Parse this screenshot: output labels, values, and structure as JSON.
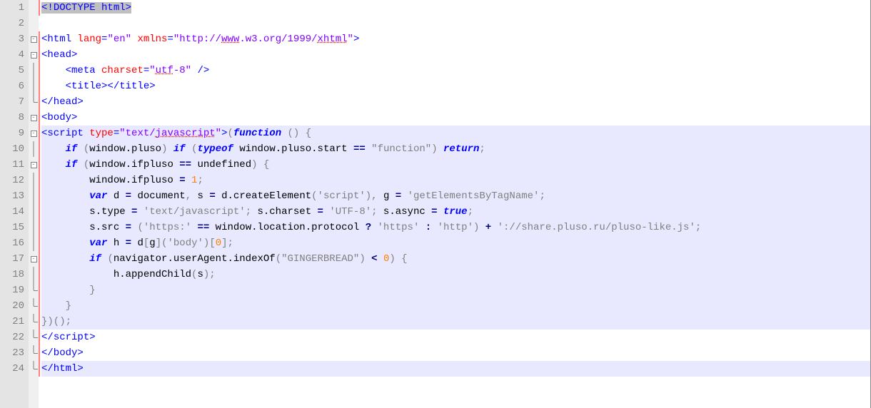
{
  "lines": [
    {
      "n": 1,
      "fold": "",
      "markred": true,
      "hl": false,
      "tokens": [
        {
          "t": "sel",
          "v": "<!"
        },
        {
          "t": "sel",
          "v": "DOCTYPE html"
        },
        {
          "t": "sel",
          "v": ">"
        }
      ]
    },
    {
      "n": 2,
      "fold": "",
      "markred": false,
      "hl": false,
      "tokens": []
    },
    {
      "n": 3,
      "fold": "box",
      "markred": true,
      "hl": false,
      "tokens": [
        {
          "t": "tag",
          "v": "<html "
        },
        {
          "t": "attr",
          "v": "lang"
        },
        {
          "t": "tag",
          "v": "="
        },
        {
          "t": "val",
          "v": "\"en\""
        },
        {
          "t": "tag",
          "v": " "
        },
        {
          "t": "attr",
          "v": "xmlns"
        },
        {
          "t": "tag",
          "v": "="
        },
        {
          "t": "val",
          "v": "\"http://"
        },
        {
          "t": "valund",
          "v": "www"
        },
        {
          "t": "val",
          "v": ".w3.org/1999/"
        },
        {
          "t": "valund",
          "v": "xhtml"
        },
        {
          "t": "val",
          "v": "\""
        },
        {
          "t": "tag",
          "v": ">"
        }
      ]
    },
    {
      "n": 4,
      "fold": "box",
      "markred": true,
      "hl": false,
      "tokens": [
        {
          "t": "tag",
          "v": "<head>"
        }
      ]
    },
    {
      "n": 5,
      "fold": "line",
      "markred": true,
      "hl": false,
      "tokens": [
        {
          "t": "txt",
          "v": "    "
        },
        {
          "t": "tag",
          "v": "<meta "
        },
        {
          "t": "attr",
          "v": "charset"
        },
        {
          "t": "tag",
          "v": "="
        },
        {
          "t": "val",
          "v": "\""
        },
        {
          "t": "valund",
          "v": "utf"
        },
        {
          "t": "val",
          "v": "-8\""
        },
        {
          "t": "tag",
          "v": " />"
        }
      ]
    },
    {
      "n": 6,
      "fold": "line",
      "markred": true,
      "hl": false,
      "tokens": [
        {
          "t": "txt",
          "v": "    "
        },
        {
          "t": "tag",
          "v": "<title></title>"
        }
      ]
    },
    {
      "n": 7,
      "fold": "end",
      "markred": true,
      "hl": false,
      "tokens": [
        {
          "t": "tag",
          "v": "</head>"
        }
      ]
    },
    {
      "n": 8,
      "fold": "box",
      "markred": true,
      "hl": false,
      "tokens": [
        {
          "t": "tag",
          "v": "<body>"
        }
      ]
    },
    {
      "n": 9,
      "fold": "box",
      "markred": true,
      "hl": true,
      "tokens": [
        {
          "t": "tag",
          "v": "<script "
        },
        {
          "t": "attr",
          "v": "type"
        },
        {
          "t": "tag",
          "v": "="
        },
        {
          "t": "val",
          "v": "\"text/"
        },
        {
          "t": "valund",
          "v": "javascript"
        },
        {
          "t": "val",
          "v": "\""
        },
        {
          "t": "tag",
          "v": ">"
        },
        {
          "t": "grey",
          "v": "("
        },
        {
          "t": "kw",
          "v": "function"
        },
        {
          "t": "txt",
          "v": " "
        },
        {
          "t": "grey",
          "v": "() {"
        }
      ]
    },
    {
      "n": 10,
      "fold": "line",
      "markred": true,
      "hl": true,
      "tokens": [
        {
          "t": "txt",
          "v": "    "
        },
        {
          "t": "kw",
          "v": "if"
        },
        {
          "t": "txt",
          "v": " "
        },
        {
          "t": "grey",
          "v": "("
        },
        {
          "t": "txt",
          "v": "window.pluso"
        },
        {
          "t": "grey",
          "v": ")"
        },
        {
          "t": "txt",
          "v": " "
        },
        {
          "t": "kw",
          "v": "if"
        },
        {
          "t": "txt",
          "v": " "
        },
        {
          "t": "grey",
          "v": "("
        },
        {
          "t": "kw",
          "v": "typeof"
        },
        {
          "t": "txt",
          "v": " window.pluso.start "
        },
        {
          "t": "op",
          "v": "=="
        },
        {
          "t": "txt",
          "v": " "
        },
        {
          "t": "str",
          "v": "\"function\""
        },
        {
          "t": "grey",
          "v": ")"
        },
        {
          "t": "txt",
          "v": " "
        },
        {
          "t": "kw",
          "v": "return"
        },
        {
          "t": "grey",
          "v": ";"
        }
      ]
    },
    {
      "n": 11,
      "fold": "box",
      "markred": true,
      "hl": true,
      "tokens": [
        {
          "t": "txt",
          "v": "    "
        },
        {
          "t": "kw",
          "v": "if"
        },
        {
          "t": "txt",
          "v": " "
        },
        {
          "t": "grey",
          "v": "("
        },
        {
          "t": "txt",
          "v": "window.ifpluso "
        },
        {
          "t": "op",
          "v": "=="
        },
        {
          "t": "txt",
          "v": " undefined"
        },
        {
          "t": "grey",
          "v": ") {"
        }
      ]
    },
    {
      "n": 12,
      "fold": "line",
      "markred": true,
      "hl": true,
      "tokens": [
        {
          "t": "txt",
          "v": "        window.ifpluso "
        },
        {
          "t": "op",
          "v": "="
        },
        {
          "t": "txt",
          "v": " "
        },
        {
          "t": "num",
          "v": "1"
        },
        {
          "t": "grey",
          "v": ";"
        }
      ]
    },
    {
      "n": 13,
      "fold": "line",
      "markred": true,
      "hl": true,
      "tokens": [
        {
          "t": "txt",
          "v": "        "
        },
        {
          "t": "kw",
          "v": "var"
        },
        {
          "t": "txt",
          "v": " d "
        },
        {
          "t": "op",
          "v": "="
        },
        {
          "t": "txt",
          "v": " document"
        },
        {
          "t": "grey",
          "v": ","
        },
        {
          "t": "txt",
          "v": " s "
        },
        {
          "t": "op",
          "v": "="
        },
        {
          "t": "txt",
          "v": " d.createElement"
        },
        {
          "t": "grey",
          "v": "("
        },
        {
          "t": "str",
          "v": "'script'"
        },
        {
          "t": "grey",
          "v": "),"
        },
        {
          "t": "txt",
          "v": " g "
        },
        {
          "t": "op",
          "v": "="
        },
        {
          "t": "txt",
          "v": " "
        },
        {
          "t": "str",
          "v": "'getElementsByTagName'"
        },
        {
          "t": "grey",
          "v": ";"
        }
      ]
    },
    {
      "n": 14,
      "fold": "line",
      "markred": true,
      "hl": true,
      "tokens": [
        {
          "t": "txt",
          "v": "        s.type "
        },
        {
          "t": "op",
          "v": "="
        },
        {
          "t": "txt",
          "v": " "
        },
        {
          "t": "str",
          "v": "'text/javascript'"
        },
        {
          "t": "grey",
          "v": ";"
        },
        {
          "t": "txt",
          "v": " s.charset "
        },
        {
          "t": "op",
          "v": "="
        },
        {
          "t": "txt",
          "v": " "
        },
        {
          "t": "str",
          "v": "'UTF-8'"
        },
        {
          "t": "grey",
          "v": ";"
        },
        {
          "t": "txt",
          "v": " s.async "
        },
        {
          "t": "op",
          "v": "="
        },
        {
          "t": "txt",
          "v": " "
        },
        {
          "t": "kw",
          "v": "true"
        },
        {
          "t": "grey",
          "v": ";"
        }
      ]
    },
    {
      "n": 15,
      "fold": "line",
      "markred": true,
      "hl": true,
      "tokens": [
        {
          "t": "txt",
          "v": "        s.src "
        },
        {
          "t": "op",
          "v": "="
        },
        {
          "t": "txt",
          "v": " "
        },
        {
          "t": "grey",
          "v": "("
        },
        {
          "t": "str",
          "v": "'https:'"
        },
        {
          "t": "txt",
          "v": " "
        },
        {
          "t": "op",
          "v": "=="
        },
        {
          "t": "txt",
          "v": " window.location.protocol "
        },
        {
          "t": "op",
          "v": "?"
        },
        {
          "t": "txt",
          "v": " "
        },
        {
          "t": "str",
          "v": "'https'"
        },
        {
          "t": "txt",
          "v": " "
        },
        {
          "t": "op",
          "v": ":"
        },
        {
          "t": "txt",
          "v": " "
        },
        {
          "t": "str",
          "v": "'http'"
        },
        {
          "t": "grey",
          "v": ")"
        },
        {
          "t": "txt",
          "v": " "
        },
        {
          "t": "op",
          "v": "+"
        },
        {
          "t": "txt",
          "v": " "
        },
        {
          "t": "str",
          "v": "'://share.pluso.ru/pluso-like.js'"
        },
        {
          "t": "grey",
          "v": ";"
        }
      ]
    },
    {
      "n": 16,
      "fold": "line",
      "markred": true,
      "hl": true,
      "tokens": [
        {
          "t": "txt",
          "v": "        "
        },
        {
          "t": "kw",
          "v": "var"
        },
        {
          "t": "txt",
          "v": " h "
        },
        {
          "t": "op",
          "v": "="
        },
        {
          "t": "txt",
          "v": " d"
        },
        {
          "t": "grey",
          "v": "["
        },
        {
          "t": "txt",
          "v": "g"
        },
        {
          "t": "grey",
          "v": "]("
        },
        {
          "t": "str",
          "v": "'body'"
        },
        {
          "t": "grey",
          "v": ")["
        },
        {
          "t": "num",
          "v": "0"
        },
        {
          "t": "grey",
          "v": "];"
        }
      ]
    },
    {
      "n": 17,
      "fold": "box",
      "markred": true,
      "hl": true,
      "tokens": [
        {
          "t": "txt",
          "v": "        "
        },
        {
          "t": "kw",
          "v": "if"
        },
        {
          "t": "txt",
          "v": " "
        },
        {
          "t": "grey",
          "v": "("
        },
        {
          "t": "txt",
          "v": "navigator.userAgent.indexOf"
        },
        {
          "t": "grey",
          "v": "("
        },
        {
          "t": "str",
          "v": "\"GINGERBREAD\""
        },
        {
          "t": "grey",
          "v": ")"
        },
        {
          "t": "txt",
          "v": " "
        },
        {
          "t": "op",
          "v": "<"
        },
        {
          "t": "txt",
          "v": " "
        },
        {
          "t": "num",
          "v": "0"
        },
        {
          "t": "grey",
          "v": ") {"
        }
      ]
    },
    {
      "n": 18,
      "fold": "line",
      "markred": true,
      "hl": true,
      "tokens": [
        {
          "t": "txt",
          "v": "            h.appendChild"
        },
        {
          "t": "grey",
          "v": "("
        },
        {
          "t": "txt",
          "v": "s"
        },
        {
          "t": "grey",
          "v": ");"
        }
      ]
    },
    {
      "n": 19,
      "fold": "end",
      "markred": true,
      "hl": true,
      "tokens": [
        {
          "t": "txt",
          "v": "        "
        },
        {
          "t": "grey",
          "v": "}"
        }
      ]
    },
    {
      "n": 20,
      "fold": "end",
      "markred": true,
      "hl": true,
      "tokens": [
        {
          "t": "txt",
          "v": "    "
        },
        {
          "t": "grey",
          "v": "}"
        }
      ]
    },
    {
      "n": 21,
      "fold": "end",
      "markred": true,
      "hl": true,
      "tokens": [
        {
          "t": "grey",
          "v": "})();"
        }
      ]
    },
    {
      "n": 22,
      "fold": "end",
      "markred": true,
      "hl": false,
      "tokens": [
        {
          "t": "tag",
          "v": "<"
        },
        {
          "t": "tag",
          "v": "/"
        },
        {
          "t": "tag",
          "v": "script>"
        }
      ]
    },
    {
      "n": 23,
      "fold": "end",
      "markred": true,
      "hl": false,
      "tokens": [
        {
          "t": "tag",
          "v": "</body>"
        }
      ]
    },
    {
      "n": 24,
      "fold": "end",
      "markred": true,
      "hl": true,
      "tokens": [
        {
          "t": "tag",
          "v": "</html>"
        }
      ]
    }
  ]
}
